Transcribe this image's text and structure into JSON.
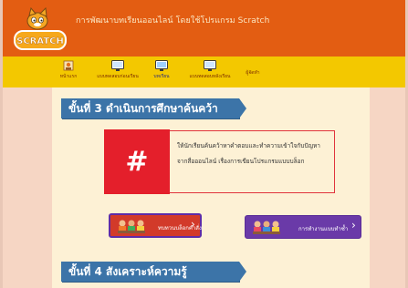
{
  "header": {
    "logo_text": "SCRATCH",
    "title": "การพัฒนาบทเรียนออนไลน์ โดยใช้โปรแกรม Scratch"
  },
  "nav": {
    "items": [
      {
        "label": "หน้าแรก",
        "icon": "home-icon"
      },
      {
        "label": "แบบทดสอบก่อนเรียน",
        "icon": "monitor-icon"
      },
      {
        "label": "บทเรียน",
        "icon": "monitor-icon",
        "active": true
      },
      {
        "label": "แบบทดสอบหลังเรียน",
        "icon": "monitor-icon"
      },
      {
        "label": "ผู้จัดทำ",
        "icon": ""
      }
    ]
  },
  "step3": {
    "title": "ขั้นที่ 3 ดำเนินการศึกษาค้นคว้า"
  },
  "step4": {
    "title": "ขั้นที่ 4 สังเคราะห์ความรู้"
  },
  "task": {
    "symbol": "#",
    "description": "ให้นักเรียนค้นคว้าหาคำตอบและทำความเข้าใจกับปัญหาจากสื่อออนไลน์ เรื่องการเขียนโปรแกรมแบบบล็อก"
  },
  "buttons": {
    "review": {
      "label": "ทบทวนบล็อกคำสั่ง",
      "chevron": "›"
    },
    "practice": {
      "label": "การทำงานแบบทำซ้ำ",
      "chevron": "›"
    }
  },
  "colors": {
    "header_bg": "#e35d12",
    "nav_bg": "#f3c800",
    "banner_bg": "#3c74a8",
    "hash_bg": "#e41f2b",
    "review_bg": "#d23a2a",
    "practice_bg": "#6a3aa8"
  }
}
